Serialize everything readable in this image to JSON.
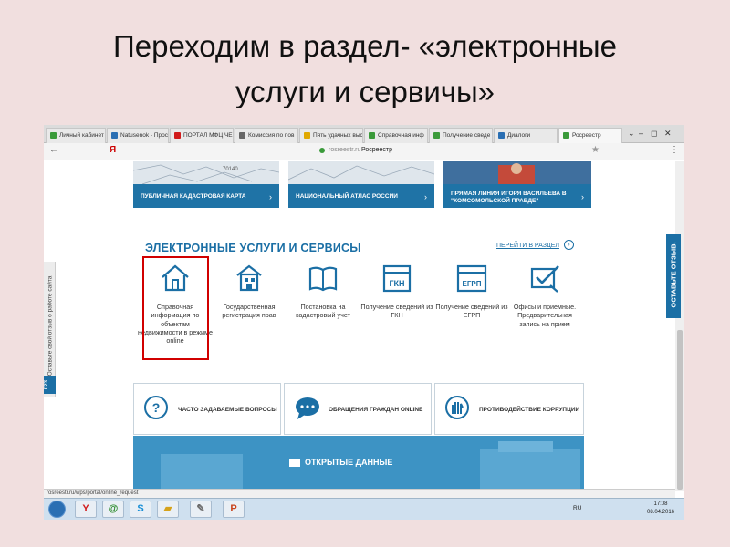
{
  "slide": {
    "title_line1": "Переходим в раздел- «электронные",
    "title_line2": "услуги и сервичы»"
  },
  "browser": {
    "tabs": [
      {
        "label": "Личный кабинет",
        "color": "#3a9a3a"
      },
      {
        "label": "Natusenok - Прос",
        "color": "#2a6fb3"
      },
      {
        "label": "ПОРТАЛ МФЦ ЧЕ",
        "color": "#d11b1b"
      },
      {
        "label": "Комиссия по пов",
        "color": "#666666"
      },
      {
        "label": "Пять удачных выс",
        "color": "#e0a800"
      },
      {
        "label": "Справочная инф",
        "color": "#3a9a3a"
      },
      {
        "label": "Получение сведе",
        "color": "#3a9a3a"
      },
      {
        "label": "Диалоги",
        "color": "#2a6fb3"
      },
      {
        "label": "Росреестр",
        "color": "#3a9a3a"
      }
    ],
    "window_controls": [
      "⌄",
      "–",
      "◻",
      "✕"
    ],
    "address": {
      "back": "←",
      "yandex": "Я",
      "domain": "rosreestr.ru",
      "site_title": "Росреестр",
      "star": "★",
      "menu": "⋮"
    },
    "status_url": "rosreestr.ru/wps/portal/online_request"
  },
  "page": {
    "banners": [
      {
        "label": "ПУБЛИЧНАЯ КАДАСТРОВАЯ КАРТА",
        "arrow": "›"
      },
      {
        "label": "НАЦИОНАЛЬНЫЙ АТЛАС РОССИИ",
        "arrow": "›"
      },
      {
        "label": "ПРЯМАЯ ЛИНИЯ ИГОРЯ ВАСИЛЬЕВА В \"КОМСОМОЛЬСКОЙ ПРАВДЕ\"",
        "arrow": "›"
      }
    ],
    "banner_map_text": "70140",
    "section_title": "ЭЛЕКТРОННЫЕ УСЛУГИ И СЕРВИСЫ",
    "section_link": "ПЕРЕЙТИ В РАЗДЕЛ",
    "section_link_icon": "›",
    "services": [
      {
        "icon": "house-icon",
        "label": "Справочная информация по объектам недвижимости в режиме online"
      },
      {
        "icon": "building-icon",
        "label": "Государственная регистрация прав"
      },
      {
        "icon": "book-icon",
        "label": "Постановка на кадастровый учет"
      },
      {
        "icon": "gkn-icon",
        "label": "Получение сведений из ГКН",
        "badge": "ГКН"
      },
      {
        "icon": "egrp-icon",
        "label": "Получение сведений из ЕГРП",
        "badge": "ЕГРП"
      },
      {
        "icon": "checkmark-icon",
        "label": "Офисы и приемные. Предварительная запись на прием"
      }
    ],
    "quick_links": [
      {
        "icon": "question-icon",
        "label": "ЧАСТО ЗАДАВАЕМЫЕ ВОПРОСЫ",
        "glyph": "?"
      },
      {
        "icon": "chat-icon",
        "label": "ОБРАЩЕНИЯ ГРАЖДАН ONLINE"
      },
      {
        "icon": "hand-icon",
        "label": "ПРОТИВОДЕЙСТВИЕ КОРРУПЦИИ"
      }
    ],
    "open_data_label": "ОТКРЫТЫЕ ДАННЫЕ",
    "side_tab_text": "Оставьте свой отзыв о работе сайта",
    "side_tab_number": "023",
    "feedback_text": "ОСТАВЬТЕ ОТЗЫВ."
  },
  "taskbar": {
    "icons": [
      {
        "name": "yandex-browser-icon",
        "glyph": "Y",
        "color": "#d11b1b"
      },
      {
        "name": "mail-agent-icon",
        "glyph": "@",
        "color": "#2a8a2a"
      },
      {
        "name": "skype-icon",
        "glyph": "S",
        "color": "#1a8fd6"
      },
      {
        "name": "folder-icon",
        "glyph": "▰",
        "color": "#d6a21a"
      },
      {
        "name": "paint-icon",
        "glyph": "✎",
        "color": "#6a6a6a"
      },
      {
        "name": "powerpoint-icon",
        "glyph": "P",
        "color": "#c8431b"
      }
    ],
    "lang": "RU",
    "time": "17:08",
    "date": "08.04.2016"
  },
  "colors": {
    "brand_blue": "#1b6fa5",
    "highlight_red": "#d10000",
    "slide_bg": "#f1dfdf"
  }
}
